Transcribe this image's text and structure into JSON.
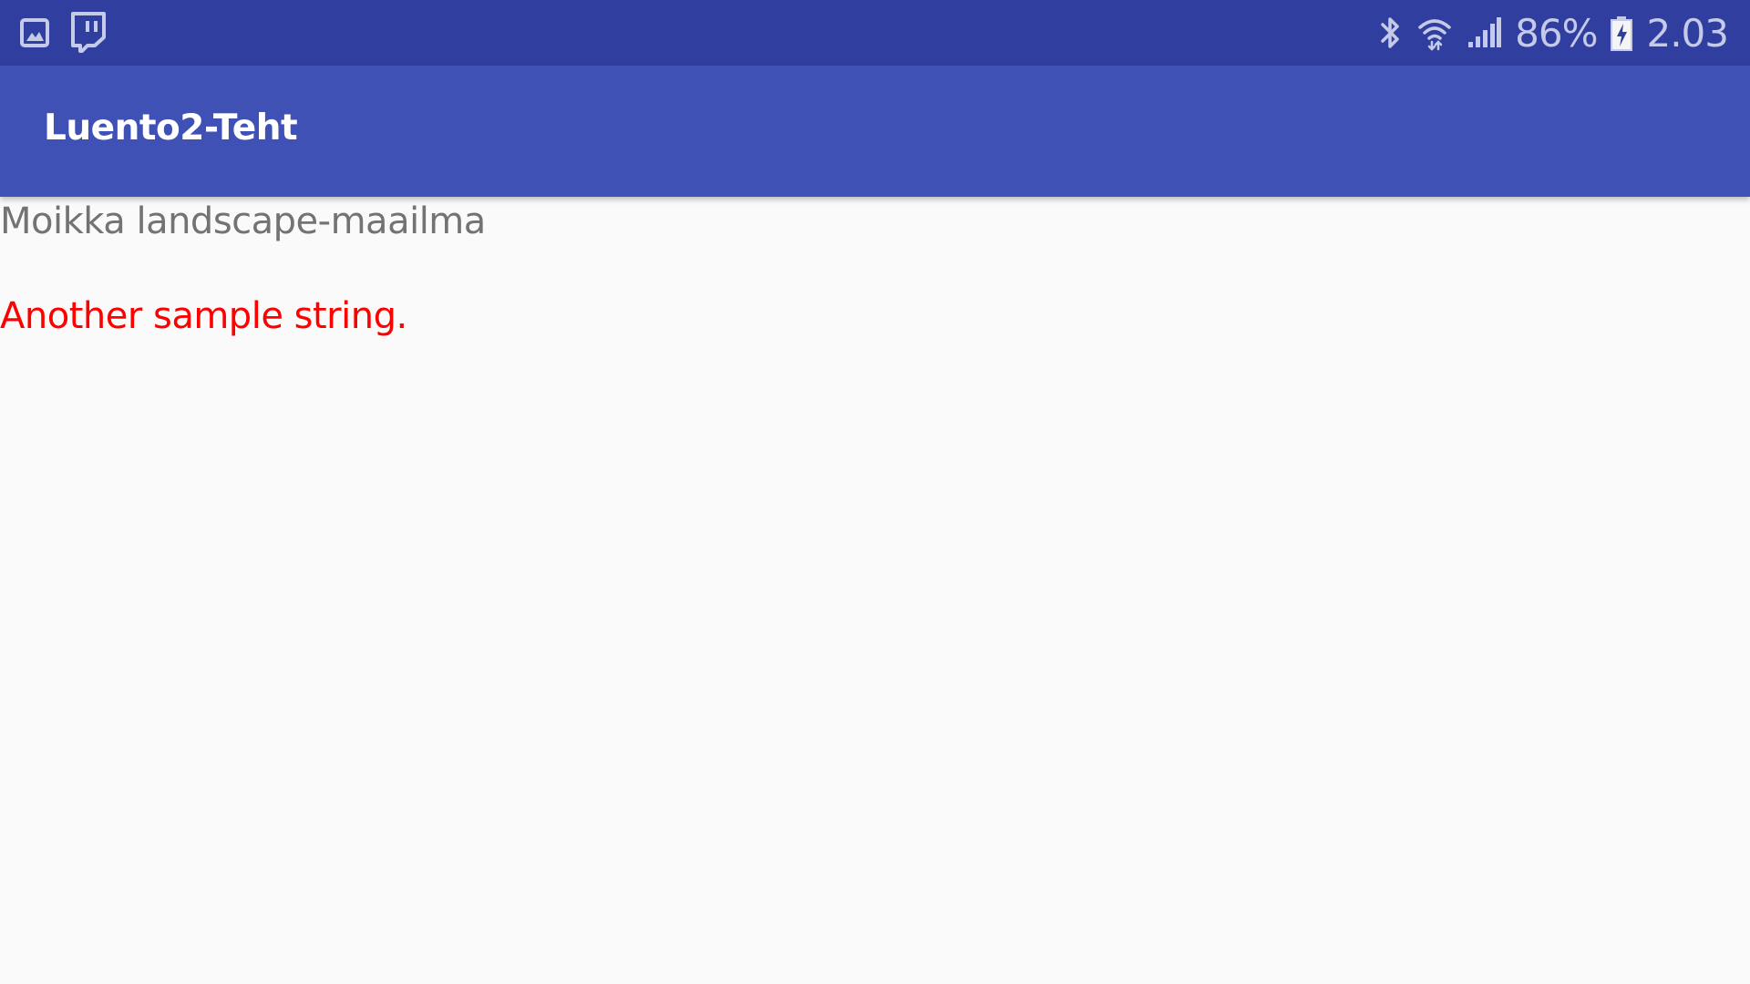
{
  "status_bar": {
    "battery_percent": "86%",
    "time": "2.03",
    "battery_level": 0.86,
    "notification_icons": [
      "gallery-icon",
      "twitch-icon"
    ],
    "status_icons": [
      "bluetooth-icon",
      "wifi-icon",
      "signal-icon",
      "battery-charging-icon"
    ],
    "background_color": "#303f9f",
    "icon_color": "#c5cae9"
  },
  "app_bar": {
    "title": "Luento2-Teht",
    "background_color": "#3f51b5",
    "title_color": "#ffffff"
  },
  "content": {
    "primary_text": "Moikka landscape-maailma",
    "accent_text": "Another sample string.",
    "primary_text_color": "#737373",
    "accent_text_color": "#ff0000",
    "background_color": "#fafafa"
  }
}
